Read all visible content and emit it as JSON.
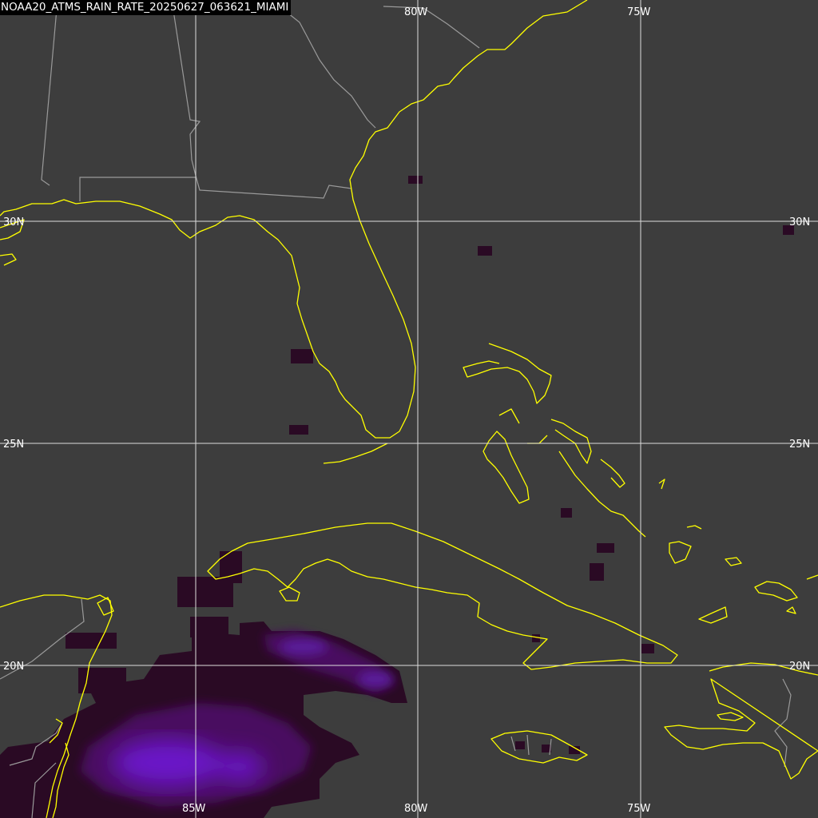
{
  "product_title": "NOAA20_ATMS_RAIN_RATE_20250627_063621_MIAMI",
  "colors": {
    "background": "#3d3d3d",
    "coastline": "#ffff00",
    "political_border": "#9a9a9a",
    "graticule": "#dddddd",
    "rain_light": "#2a0a24",
    "rain_moderate": "#5a1270",
    "rain_heavy": "#6a18c8"
  },
  "graticule": {
    "longitudes": [
      {
        "label_top": "80W",
        "label_bottom": "80W"
      },
      {
        "label_top": "75W",
        "label_bottom": "75W"
      },
      {
        "label_top": "",
        "label_bottom": "85W"
      }
    ],
    "latitudes": [
      {
        "label_left": "30N",
        "label_right": "30N"
      },
      {
        "label_left": "25N",
        "label_right": "25N"
      },
      {
        "label_left": "20N",
        "label_right": "20N"
      }
    ]
  }
}
